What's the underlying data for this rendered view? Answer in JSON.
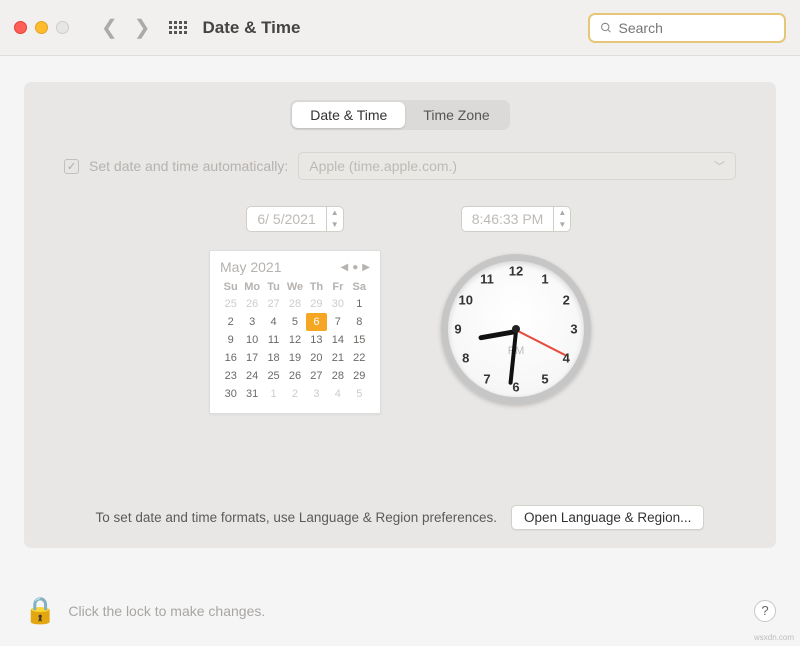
{
  "titlebar": {
    "title": "Date & Time",
    "search_placeholder": "Search"
  },
  "tabs": {
    "date_time": "Date & Time",
    "time_zone": "Time Zone"
  },
  "auto": {
    "label": "Set date and time automatically:",
    "server": "Apple (time.apple.com.)"
  },
  "date_field": "6/  5/2021",
  "time_field": "8:46:33 PM",
  "calendar": {
    "month": "May 2021",
    "dow": [
      "Su",
      "Mo",
      "Tu",
      "We",
      "Th",
      "Fr",
      "Sa"
    ],
    "cells": [
      {
        "n": "25",
        "out": true
      },
      {
        "n": "26",
        "out": true
      },
      {
        "n": "27",
        "out": true
      },
      {
        "n": "28",
        "out": true
      },
      {
        "n": "29",
        "out": true
      },
      {
        "n": "30",
        "out": true
      },
      {
        "n": "1"
      },
      {
        "n": "2"
      },
      {
        "n": "3"
      },
      {
        "n": "4"
      },
      {
        "n": "5"
      },
      {
        "n": "6",
        "sel": true
      },
      {
        "n": "7"
      },
      {
        "n": "8"
      },
      {
        "n": "9"
      },
      {
        "n": "10"
      },
      {
        "n": "11"
      },
      {
        "n": "12"
      },
      {
        "n": "13"
      },
      {
        "n": "14"
      },
      {
        "n": "15"
      },
      {
        "n": "16"
      },
      {
        "n": "17"
      },
      {
        "n": "18"
      },
      {
        "n": "19"
      },
      {
        "n": "20"
      },
      {
        "n": "21"
      },
      {
        "n": "22"
      },
      {
        "n": "23"
      },
      {
        "n": "24"
      },
      {
        "n": "25"
      },
      {
        "n": "26"
      },
      {
        "n": "27"
      },
      {
        "n": "28"
      },
      {
        "n": "29"
      },
      {
        "n": "30"
      },
      {
        "n": "31"
      },
      {
        "n": "1",
        "out": true
      },
      {
        "n": "2",
        "out": true
      },
      {
        "n": "3",
        "out": true
      },
      {
        "n": "4",
        "out": true
      },
      {
        "n": "5",
        "out": true
      }
    ]
  },
  "clock": {
    "ampm": "PM"
  },
  "footer": {
    "note": "To set date and time formats, use Language & Region preferences.",
    "button": "Open Language & Region..."
  },
  "lock": {
    "text": "Click the lock to make changes."
  },
  "watermark": "wsxdn.com"
}
